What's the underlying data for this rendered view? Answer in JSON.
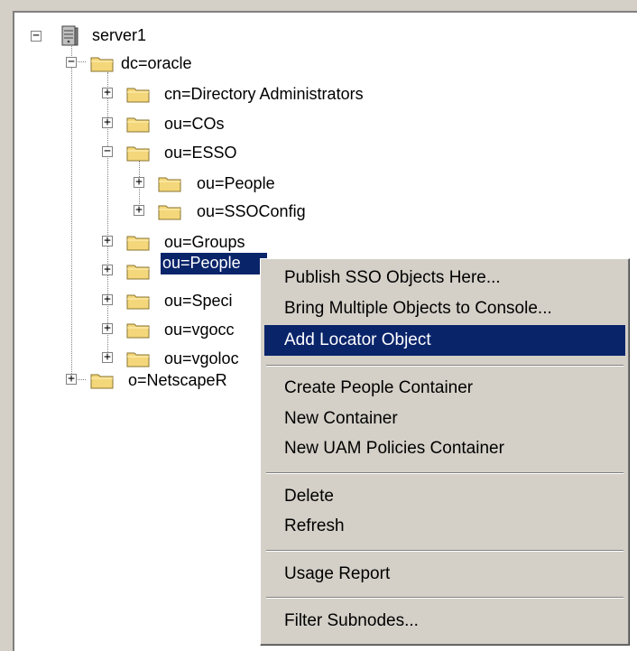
{
  "tree": {
    "root": {
      "label": "server1",
      "expander": "−"
    },
    "nodes": [
      {
        "label": "dc=oracle",
        "expander": "−"
      },
      {
        "label": "cn=Directory Administrators",
        "expander": "+"
      },
      {
        "label": "ou=COs",
        "expander": "+"
      },
      {
        "label": "ou=ESSO",
        "expander": "−"
      },
      {
        "label": "ou=People",
        "expander": "+"
      },
      {
        "label": "ou=SSOConfig",
        "expander": "+"
      },
      {
        "label": "ou=Groups",
        "expander": "+"
      },
      {
        "label": "ou=People",
        "expander": "+"
      },
      {
        "label": "ou=Speci",
        "expander": "+"
      },
      {
        "label": "ou=vgocc",
        "expander": "+"
      },
      {
        "label": "ou=vgoloc",
        "expander": "+"
      },
      {
        "label": "o=NetscapeR",
        "expander": "+"
      }
    ]
  },
  "context_menu": {
    "items": [
      "Publish SSO Objects Here...",
      "Bring Multiple Objects to Console...",
      "Add Locator Object",
      "Create People Container",
      "New Container",
      "New UAM Policies Container",
      "Delete",
      "Refresh",
      "Usage Report",
      "Filter Subnodes..."
    ],
    "highlighted": "Add Locator Object"
  },
  "colors": {
    "selection": "#0a246a",
    "face": "#d4d0c8",
    "folder": "#f4d77a"
  },
  "icons": [
    "server-icon",
    "folder-icon",
    "expand-icon",
    "collapse-icon"
  ]
}
